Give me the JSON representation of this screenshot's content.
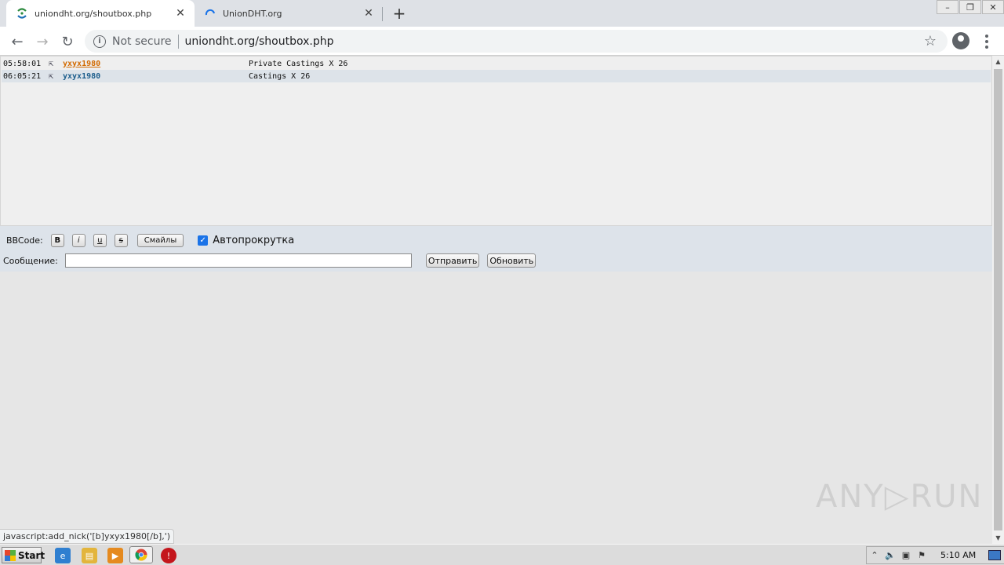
{
  "browser": {
    "tabs": [
      {
        "title": "uniondht.org/shoutbox.php",
        "active": true
      },
      {
        "title": "UnionDHT.org",
        "active": false
      }
    ],
    "address": {
      "security_label": "Not secure",
      "url": "uniondht.org/shoutbox.php"
    },
    "status_url": "javascript:add_nick('[b]yxyx1980[/b],')"
  },
  "shoutbox": {
    "messages": [
      {
        "time": "05:58:01",
        "nick": "yxyx1980",
        "text": "Private Castings X 26"
      },
      {
        "time": "06:05:21",
        "nick": "yxyx1980",
        "text": "Castings X 26"
      }
    ]
  },
  "controls": {
    "bbcode_label": "BBCode:",
    "bold_label": "B",
    "italic_label": "i",
    "underline_label": "u",
    "strike_label": "s",
    "smiles_label": "Смайлы",
    "autoscroll_label": "Автопрокрутка",
    "message_label": "Сообщение:",
    "message_value": "",
    "send_label": "Отправить",
    "refresh_label": "Обновить"
  },
  "watermark": "ANY▷RUN",
  "taskbar": {
    "start_label": "Start",
    "clock": "5:10 AM"
  }
}
